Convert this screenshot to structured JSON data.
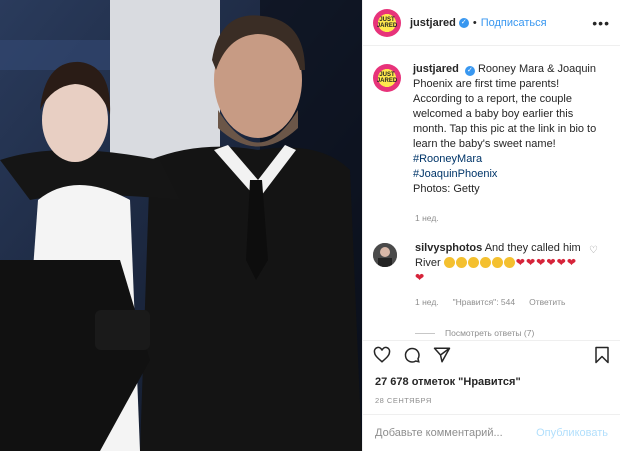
{
  "header": {
    "username": "justjared",
    "avatar_text": "JUST JARED",
    "follow_label": "Подписаться",
    "separator": "•",
    "more_label": "•••"
  },
  "caption": {
    "username": "justjared",
    "text": "Rooney Mara & Joaquin Phoenix are first time parents! According to a report, the couple welcomed a baby boy earlier this month. Tap this pic at the link in bio to learn the baby's sweet name!",
    "tags": [
      "#RooneyMara",
      "#JoaquinPhoenix"
    ],
    "credit": "Photos: Getty",
    "time": "1 нед."
  },
  "comment": {
    "username": "silvysphotos",
    "text": "And they called him River",
    "time": "1 нед.",
    "likes": "\"Нравится\": 544",
    "reply_label": "Ответить",
    "view_replies": "Посмотреть ответы (7)"
  },
  "post": {
    "likes_text": "27 678 отметок \"Нравится\"",
    "date": "28 СЕНТЯБРЯ"
  },
  "add_comment": {
    "placeholder": "Добавьте комментарий...",
    "post_label": "Опубликовать"
  },
  "colors": {
    "accent": "#3897f0",
    "hashtag": "#003569",
    "muted": "#8e8e8e"
  },
  "icons": [
    "verified-icon",
    "more-icon",
    "heart-icon",
    "comment-icon",
    "share-icon",
    "bookmark-icon"
  ]
}
